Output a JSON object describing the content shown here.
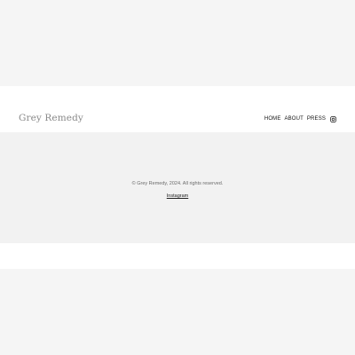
{
  "header": {
    "brand": "Grey Remedy",
    "nav": {
      "home": "HOME",
      "about": "ABOUT",
      "press": "PRESS",
      "instagram_icon": "instagram-icon"
    }
  },
  "footer": {
    "copyright": "© Grey Remedy, 2024. All rights reserved.",
    "instagram_link": "Instagram"
  },
  "colors": {
    "page_bg": "#f5f5f5",
    "header_bg": "#ffffff",
    "footer_bg": "#f2f2f2",
    "brand_text": "#8a8a8a"
  }
}
